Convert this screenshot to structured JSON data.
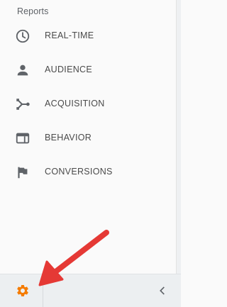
{
  "sidebar": {
    "section_title": "Reports",
    "items": [
      {
        "label": "REAL-TIME",
        "icon": "clock-icon"
      },
      {
        "label": "AUDIENCE",
        "icon": "person-icon"
      },
      {
        "label": "ACQUISITION",
        "icon": "acquisition-fork-icon"
      },
      {
        "label": "BEHAVIOR",
        "icon": "browser-window-icon"
      },
      {
        "label": "CONVERSIONS",
        "icon": "flag-icon"
      }
    ]
  },
  "footer": {
    "admin_icon": "gear-icon",
    "collapse_icon": "chevron-left-icon"
  },
  "colors": {
    "icon": "#5f6368",
    "label": "#4a4a4a",
    "gear": "#f57c00",
    "annotation_arrow": "#e53935"
  }
}
